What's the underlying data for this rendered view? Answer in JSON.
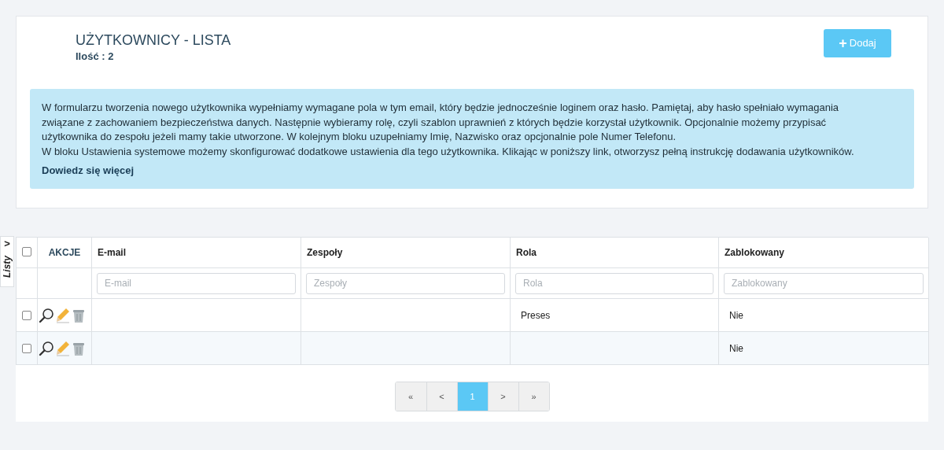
{
  "header": {
    "title": "UŻYTKOWNICY - LISTA",
    "count": "Ilość : 2",
    "add_button": {
      "icon": "+",
      "label": "Dodaj"
    }
  },
  "info": {
    "paragraphs": [
      "W formularzu tworzenia nowego użytkownika wypełniamy wymagane pola w tym email, który będzie jednocześnie loginem oraz hasło. Pamiętaj, aby hasło spełniało wymagania związane z zachowaniem bezpieczeństwa danych. Następnie wybieramy rolę, czyli szablon uprawnień z których będzie korzystał użytkownik. Opcjonalnie możemy przypisać użytkownika do zespołu jeżeli mamy takie utworzone. W kolejnym bloku uzupełniamy Imię, Nazwisko oraz opcjonalnie pole Numer Telefonu.",
      "W bloku Ustawienia systemowe możemy skonfigurować dodatkowe ustawienia dla tego użytkownika. Klikając w poniższy link, otworzysz pełną instrukcję dodawania użytkowników."
    ],
    "link": "Dowiedz się więcej"
  },
  "side_tab": {
    "label": "Listy",
    "icon": ">"
  },
  "table": {
    "select_all": {
      "checked": false
    },
    "actions_header": "AKCJE",
    "columns": [
      {
        "label": "E-mail",
        "placeholder": "E-mail"
      },
      {
        "label": "Zespoły",
        "placeholder": "Zespoły"
      },
      {
        "label": "Rola",
        "placeholder": "Rola"
      },
      {
        "label": "Zablokowany",
        "placeholder": "Zablokowany"
      }
    ],
    "rows": [
      {
        "checked": false,
        "cells": [
          "",
          "",
          "Preses",
          "Nie"
        ]
      },
      {
        "checked": false,
        "cells": [
          "",
          "",
          "",
          "Nie"
        ]
      }
    ]
  },
  "pagination": [
    {
      "label": "«",
      "selected": false
    },
    {
      "label": "<",
      "selected": false
    },
    {
      "label": "1",
      "selected": true
    },
    {
      "label": ">",
      "selected": false
    },
    {
      "label": "»",
      "selected": false
    }
  ]
}
